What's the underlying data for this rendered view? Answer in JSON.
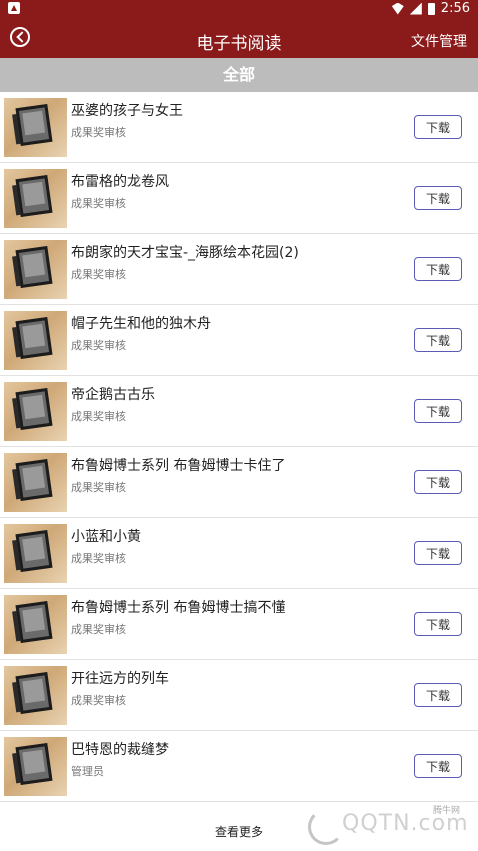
{
  "status_bar": {
    "time": "2:56"
  },
  "toolbar": {
    "title": "电子书阅读",
    "file_manage": "文件管理"
  },
  "section": {
    "title": "全部"
  },
  "books": [
    {
      "title": "巫婆的孩子与女王",
      "subtitle": "成果奖审核",
      "action": "下载"
    },
    {
      "title": "布雷格的龙卷风",
      "subtitle": "成果奖审核",
      "action": "下载"
    },
    {
      "title": "布朗家的天才宝宝-_海豚绘本花园(2)",
      "subtitle": "成果奖审核",
      "action": "下载"
    },
    {
      "title": "帽子先生和他的独木舟",
      "subtitle": "成果奖审核",
      "action": "下载"
    },
    {
      "title": "帝企鹅古古乐",
      "subtitle": "成果奖审核",
      "action": "下载"
    },
    {
      "title": "布鲁姆博士系列 布鲁姆博士卡住了",
      "subtitle": "成果奖审核",
      "action": "下载"
    },
    {
      "title": "小蓝和小黄",
      "subtitle": "成果奖审核",
      "action": "下载"
    },
    {
      "title": "布鲁姆博士系列 布鲁姆博士搞不懂",
      "subtitle": "成果奖审核",
      "action": "下载"
    },
    {
      "title": "开往远方的列车",
      "subtitle": "成果奖审核",
      "action": "下载"
    },
    {
      "title": "巴特恩的裁缝梦",
      "subtitle": "管理员",
      "action": "下载"
    }
  ],
  "footer": {
    "more": "查看更多"
  },
  "watermark": {
    "text": "QQTN.com",
    "cn": "腾牛网"
  },
  "colors": {
    "primary": "#8b1a1a",
    "section_bg": "#bcbcbc",
    "button_border": "#5b5bb6"
  }
}
